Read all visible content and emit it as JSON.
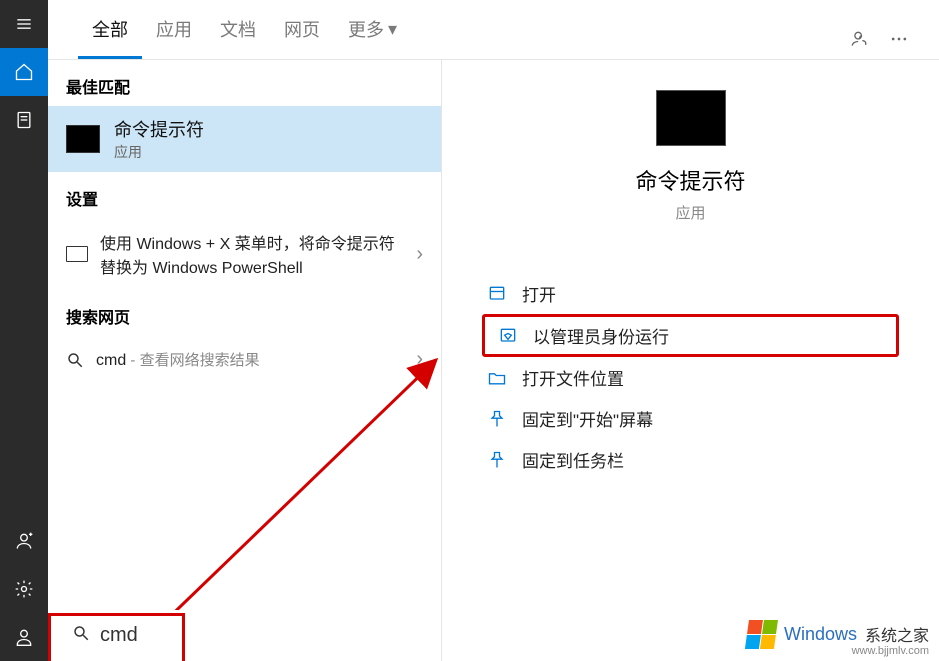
{
  "tabs": {
    "all": "全部",
    "apps": "应用",
    "docs": "文档",
    "web": "网页",
    "more": "更多"
  },
  "sections": {
    "best_match": "最佳匹配",
    "settings": "设置",
    "search_web": "搜索网页"
  },
  "best_match": {
    "title": "命令提示符",
    "sub": "应用"
  },
  "setting_item": "使用 Windows + X 菜单时，将命令提示符替换为 Windows PowerShell",
  "web_item": {
    "term": "cmd",
    "suffix": " - 查看网络搜索结果"
  },
  "detail": {
    "title": "命令提示符",
    "sub": "应用"
  },
  "actions": {
    "open": "打开",
    "run_admin": "以管理员身份运行",
    "open_location": "打开文件位置",
    "pin_start": "固定到\"开始\"屏幕",
    "pin_taskbar": "固定到任务栏"
  },
  "search_value": "cmd",
  "watermark": {
    "brand": "Windows",
    "site": "系统之家",
    "url": "www.bjjmlv.com"
  }
}
